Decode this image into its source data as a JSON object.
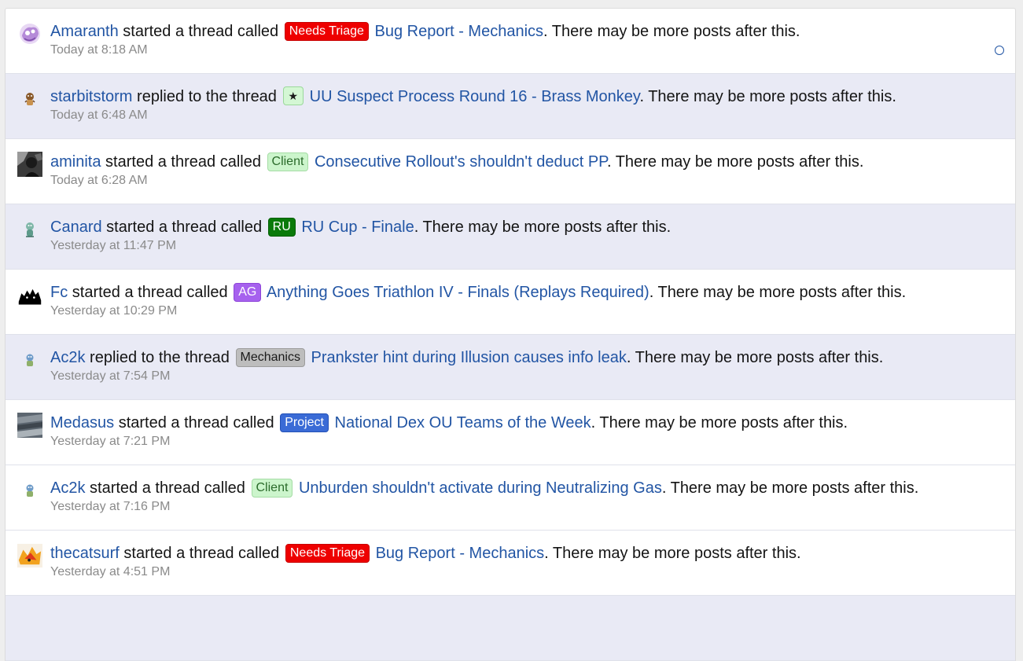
{
  "feed": {
    "items": [
      {
        "user": "Amaranth",
        "action": "started a thread called",
        "prefix": "Needs Triage",
        "title": "Bug Report - Mechanics",
        "suffix": ". There may be more posts after this.",
        "time": "Today at 8:18 AM"
      },
      {
        "user": "starbitstorm",
        "action": "replied to the thread",
        "prefix": "★",
        "title": "UU Suspect Process Round 16 - Brass Monkey",
        "suffix": ". There may be more posts after this.",
        "time": "Today at 6:48 AM"
      },
      {
        "user": "aminita",
        "action": "started a thread called",
        "prefix": "Client",
        "title": "Consecutive Rollout's shouldn't deduct PP",
        "suffix": ". There may be more posts after this.",
        "time": "Today at 6:28 AM"
      },
      {
        "user": "Canard",
        "action": "started a thread called",
        "prefix": "RU",
        "title": "RU Cup - Finale",
        "suffix": ". There may be more posts after this.",
        "time": "Yesterday at 11:47 PM"
      },
      {
        "user": "Fc",
        "action": "started a thread called",
        "prefix": "AG",
        "title": "Anything Goes Triathlon IV - Finals (Replays Required)",
        "suffix": ". There may be more posts after this.",
        "time": "Yesterday at 10:29 PM"
      },
      {
        "user": "Ac2k",
        "action": "replied to the thread",
        "prefix": "Mechanics",
        "title": "Prankster hint during Illusion causes info leak",
        "suffix": ". There may be more posts after this.",
        "time": "Yesterday at 7:54 PM"
      },
      {
        "user": "Medasus",
        "action": "started a thread called",
        "prefix": "Project",
        "title": "National Dex OU Teams of the Week",
        "suffix": ". There may be more posts after this.",
        "time": "Yesterday at 7:21 PM"
      },
      {
        "user": "Ac2k",
        "action": "started a thread called",
        "prefix": "Client",
        "title": "Unburden shouldn't activate during Neutralizing Gas",
        "suffix": ". There may be more posts after this.",
        "time": "Yesterday at 7:16 PM"
      },
      {
        "user": "thecatsurf",
        "action": "started a thread called",
        "prefix": "Needs Triage",
        "title": "Bug Report - Mechanics",
        "suffix": ". There may be more posts after this.",
        "time": "Yesterday at 4:51 PM"
      }
    ]
  },
  "colors": {
    "link": "#2255a4",
    "alt_row": "#e9eaf5",
    "needs_triage": "#ee0000",
    "ru": "#0a7a0a",
    "ag": "#a661ee",
    "project": "#3a6bd6",
    "client": "#ccf5cc"
  },
  "icons": {
    "mark_read": "circle-outline-icon"
  }
}
